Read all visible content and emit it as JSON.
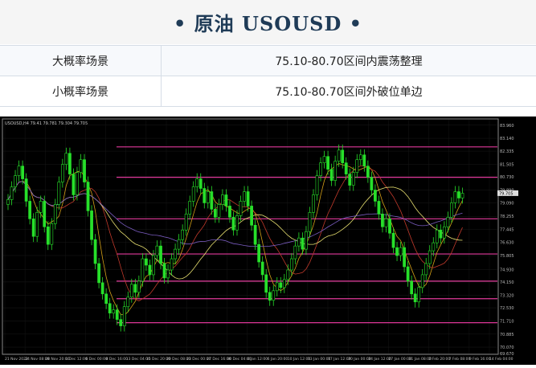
{
  "header": {
    "bullet_left": "•",
    "title": "原油 USOUSD",
    "bullet_right": "•"
  },
  "scenarios": [
    {
      "label": "大概率场景",
      "value": "75.10-80.70区间内震荡整理"
    },
    {
      "label": "小概率场景",
      "value": "75.10-80.70区间外破位单边"
    }
  ],
  "chart_data": {
    "type": "candlestick",
    "symbol_label": "USOUSD,H4  79.41 79.781 79.304 79.705",
    "price_axis_labels": [
      "83.960",
      "83.140",
      "82.335",
      "81.505",
      "80.730",
      "79.890",
      "79.090",
      "78.255",
      "77.445",
      "76.630",
      "75.805",
      "74.930",
      "74.150",
      "73.320",
      "72.530",
      "71.710",
      "70.885",
      "70.070",
      "69.670"
    ],
    "current_price": "79.705",
    "time_axis_labels": [
      "21 Nov 2022",
      "24 Nov 08:00",
      "28 Nov 20:00",
      "1 Dec 12:00",
      "6 Dec 00:00",
      "8 Dec 16:00",
      "13 Dec 04:00",
      "15 Dec 20:00",
      "20 Dec 08:00",
      "23 Dec 00:00",
      "27 Dec 16:00",
      "30 Dec 04:00",
      "4 Jan 12:00",
      "6 Jan 20:00",
      "10 Jan 12:00",
      "13 Jan 00:00",
      "17 Jan 12:00",
      "20 Jan 00:00",
      "24 Jan 12:00",
      "27 Jan 00:00",
      "31 Jan 08:00",
      "2 Feb 20:00",
      "7 Feb 08:00",
      "9 Feb 16:00",
      "14 Feb 04:00"
    ],
    "ylim": [
      69.67,
      84.3
    ],
    "fib_levels": [
      82.6,
      80.7,
      78.1,
      75.9,
      74.2,
      73.1,
      71.6
    ],
    "close_series": [
      79.3,
      80.1,
      80.8,
      81.4,
      80.6,
      79.2,
      78.1,
      77.0,
      78.5,
      79.2,
      77.6,
      76.5,
      77.8,
      79.0,
      80.4,
      81.5,
      82.2,
      80.9,
      79.6,
      81.0,
      81.8,
      80.4,
      78.6,
      76.8,
      75.3,
      74.1,
      73.4,
      72.8,
      72.2,
      72.4,
      71.8,
      71.4,
      72.6,
      73.2,
      74.0,
      73.5,
      74.2,
      75.6,
      75.2,
      74.6,
      75.8,
      76.4,
      75.3,
      74.4,
      74.9,
      75.6,
      76.2,
      76.8,
      77.4,
      78.4,
      79.2,
      80.1,
      80.6,
      80.0,
      79.1,
      79.8,
      78.7,
      78.2,
      79.0,
      79.6,
      78.9,
      78.2,
      77.4,
      78.3,
      79.2,
      79.8,
      78.9,
      77.7,
      76.5,
      75.4,
      74.6,
      73.5,
      73.0,
      73.6,
      74.1,
      73.8,
      74.3,
      74.9,
      75.6,
      76.4,
      76.9,
      76.2,
      77.3,
      78.5,
      79.6,
      80.8,
      81.6,
      82.0,
      81.2,
      80.5,
      81.7,
      82.4,
      81.6,
      80.9,
      80.2,
      81.0,
      81.8,
      82.1,
      81.4,
      80.7,
      79.9,
      79.2,
      78.4,
      77.6,
      78.1,
      77.2,
      76.3,
      75.8,
      76.3,
      75.1,
      74.2,
      73.4,
      72.9,
      73.8,
      74.6,
      75.3,
      76.1,
      76.6,
      77.4,
      76.9,
      77.6,
      78.2,
      79.1,
      79.8,
      79.4,
      79.7
    ]
  }
}
